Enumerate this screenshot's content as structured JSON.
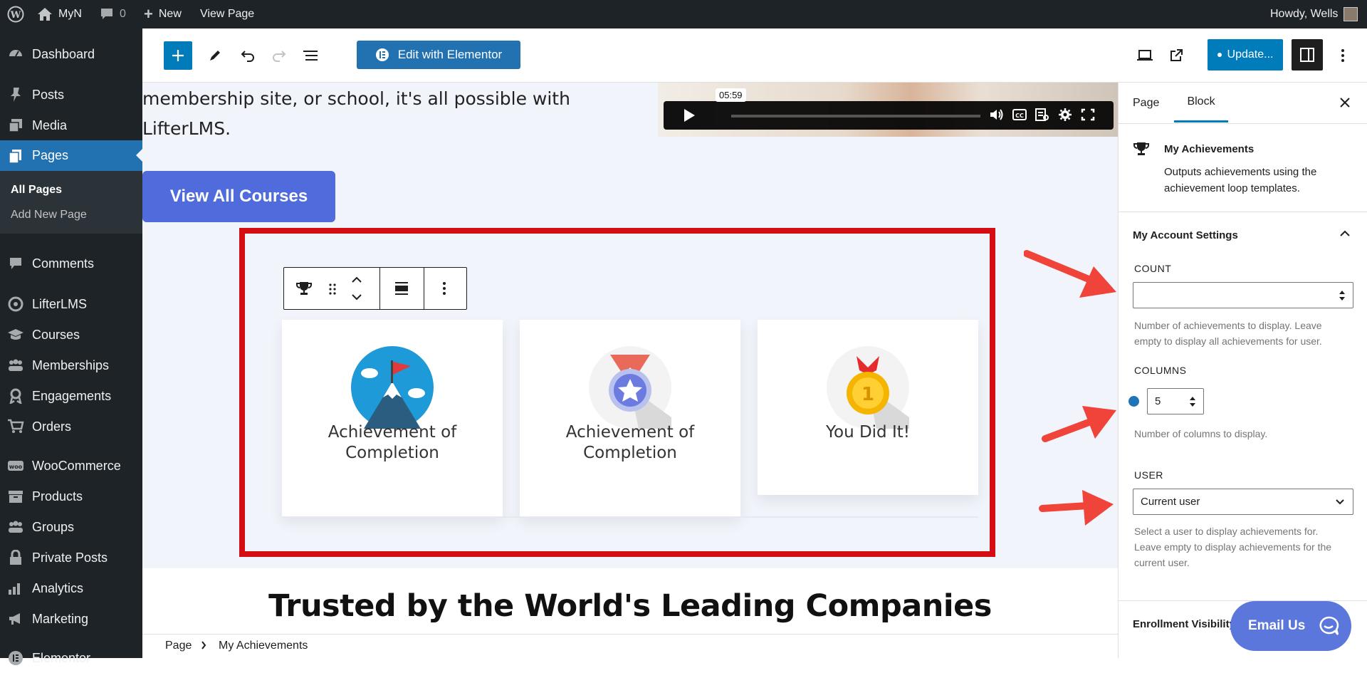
{
  "admin_bar": {
    "site_name": "MyN",
    "comments_count": "0",
    "new_label": "New",
    "view_page_label": "View Page",
    "greeting": "Howdy, Wells"
  },
  "sidebar": {
    "items": [
      {
        "label": "Dashboard",
        "icon": "dashboard-icon"
      },
      {
        "label": "Posts",
        "icon": "pin-icon"
      },
      {
        "label": "Media",
        "icon": "media-icon"
      },
      {
        "label": "Pages",
        "icon": "pages-icon"
      },
      {
        "label": "Comments",
        "icon": "comment-icon"
      },
      {
        "label": "LifterLMS",
        "icon": "lifterlms-icon"
      },
      {
        "label": "Courses",
        "icon": "graduation-cap-icon"
      },
      {
        "label": "Memberships",
        "icon": "groups-icon"
      },
      {
        "label": "Engagements",
        "icon": "award-icon"
      },
      {
        "label": "Orders",
        "icon": "cart-icon"
      },
      {
        "label": "WooCommerce",
        "icon": "woocommerce-icon"
      },
      {
        "label": "Products",
        "icon": "archive-icon"
      },
      {
        "label": "Groups",
        "icon": "groups-icon"
      },
      {
        "label": "Private Posts",
        "icon": "lock-icon"
      },
      {
        "label": "Analytics",
        "icon": "bar-chart-icon"
      },
      {
        "label": "Marketing",
        "icon": "megaphone-icon"
      },
      {
        "label": "Elementor",
        "icon": "elementor-icon"
      }
    ],
    "submenu": [
      "All Pages",
      "Add New Page"
    ]
  },
  "toolbar": {
    "elementor_label": "Edit with Elementor",
    "update_label": "Update..."
  },
  "canvas": {
    "intro_text_line1": "membership site, or school, it's all possible with",
    "intro_text_line2": "LifterLMS.",
    "video_time": "05:59",
    "view_courses_label": "View All Courses",
    "achievements": [
      {
        "title_line1": "Achievement of",
        "title_line2": "Completion",
        "icon": "mountain-flag-icon"
      },
      {
        "title_line1": "Achievement of",
        "title_line2": "Completion",
        "icon": "medal-star-icon"
      },
      {
        "title_line1": "You Did It!",
        "title_line2": "",
        "icon": "gold-medal-icon"
      }
    ],
    "trusted_heading": "Trusted by the World's Leading Companies"
  },
  "panel": {
    "tab_page": "Page",
    "tab_block": "Block",
    "block_title": "My Achievements",
    "block_desc_line1": "Outputs achievements using the",
    "block_desc_line2": "achievement loop templates.",
    "section_title": "My Account Settings",
    "count_label": "COUNT",
    "count_value": "",
    "count_help_line1": "Number of achievements to display. Leave",
    "count_help_line2": "empty to display all achievements for user.",
    "columns_label": "COLUMNS",
    "columns_value": "5",
    "columns_help": "Number of columns to display.",
    "user_label": "USER",
    "user_value": "Current user",
    "user_help_line1": "Select a user to display achievements for.",
    "user_help_line2": "Leave empty to display achievements for the",
    "user_help_line3": "current user.",
    "next_section": "Enrollment Visibility",
    "email_us_label": "Email Us"
  },
  "footer": {
    "crumb_root": "Page",
    "crumb_current": "My Achievements"
  },
  "colors": {
    "wp_dark": "#1d2327",
    "wp_blue": "#2271b1",
    "editor_blue": "#007cba",
    "highlight_red": "#d40d12",
    "button_blue": "#4f6bdc"
  }
}
